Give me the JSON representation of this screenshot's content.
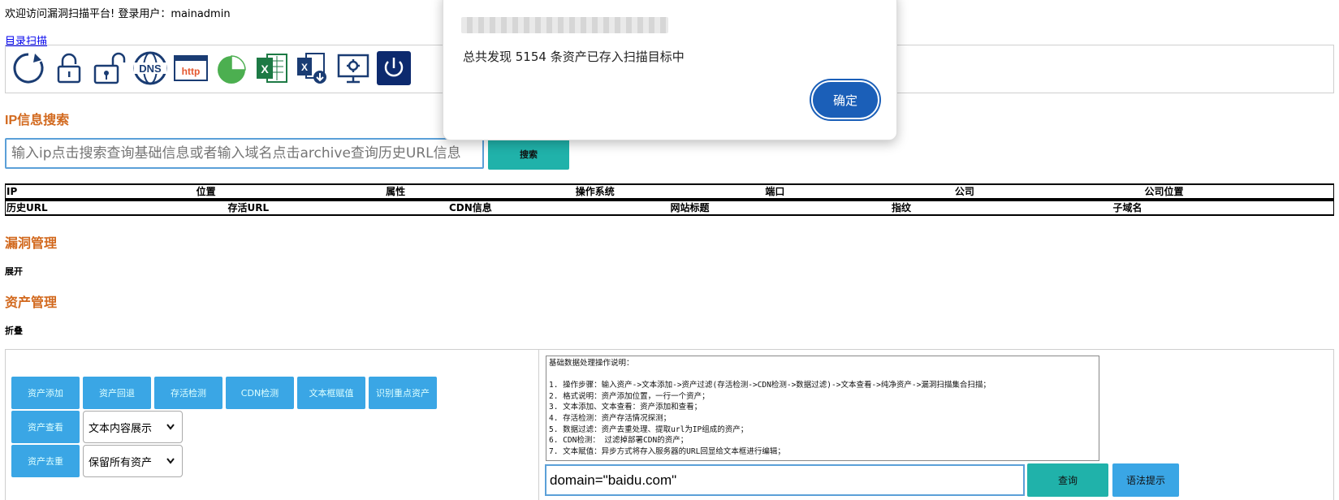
{
  "header": {
    "welcome": "欢迎访问漏洞扫描平台!  登录用户：mainadmin",
    "dir_scan_link": "目录扫描"
  },
  "toolbar": {
    "icons": [
      "refresh-icon",
      "unlock-icon",
      "lock-open-icon",
      "dns-icon",
      "http-icon",
      "pie-chart-icon",
      "excel-icon",
      "excel-download-icon",
      "monitor-settings-icon",
      "power-icon"
    ],
    "dns_label": "DNS",
    "http_label": "http"
  },
  "ip_search": {
    "title": "IP信息搜索",
    "placeholder": "输入ip点击搜索查询基础信息或者输入域名点击archive查询历史URL信息",
    "button": "搜索"
  },
  "ip_table": {
    "row1": [
      "IP",
      "位置",
      "属性",
      "操作系统",
      "端口",
      "公司",
      "公司位置"
    ],
    "row2": [
      "历史URL",
      "存活URL",
      "CDN信息",
      "网站标题",
      "指纹",
      "子域名"
    ]
  },
  "vuln_mgmt": {
    "title": "漏洞管理",
    "toggle": "展开"
  },
  "asset_mgmt": {
    "title": "资产管理",
    "toggle": "折叠",
    "buttons_row1": [
      "资产添加",
      "资产回退",
      "存活检测",
      "CDN检测",
      "文本框赋值",
      "识别重点资产"
    ],
    "button_view": "资产查看",
    "button_dedup": "资产去重",
    "select_display": "文本内容展示",
    "select_keep": "保留所有资产",
    "notes": "基础数据处理操作说明：\n\n1. 操作步骤：输入资产->文本添加->资产过滤(存活检测->CDN检测->数据过滤)->文本查看->纯净资产->漏洞扫描集合扫描；\n2. 格式说明：资产添加位置，一行一个资产；\n3. 文本添加、文本查看：资产添加和查看；\n4. 存活检测：资产存活情况探测；\n5. 数据过滤：资产去重处理、提取url为IP组成的资产；\n6. CDN检测： 过滤掉部署CDN的资产；\n7. 文本赋值：异步方式将存入服务器的URL回显给文本框进行编辑；",
    "query_value": "domain=\"baidu.com\"",
    "query_button": "查询",
    "syntax_button": "语法提示"
  },
  "dialog": {
    "message": "总共发现 5154 条资产已存入扫描目标中",
    "ok_button": "确定"
  },
  "colors": {
    "section_title": "#d2691e",
    "teal_button": "#20b2aa",
    "blue_button": "#3aa6e5",
    "dialog_ok": "#1b5fb8"
  }
}
